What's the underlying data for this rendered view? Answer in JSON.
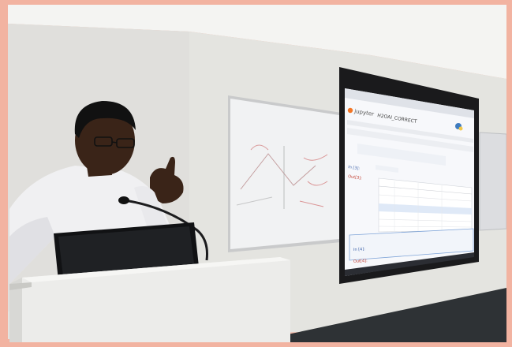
{
  "photo": {
    "description_hidden": false
  },
  "projection": {
    "app_name": "jupyter",
    "notebook_name": "H2OAI_CORRECT",
    "cell_in_1": "In [3]:",
    "cell_out_1": "Out[3]:",
    "cell_in_2": "In [4]:",
    "cell_out_2": "Out[4]:"
  },
  "colors": {
    "frame": "#f2b3a1",
    "wall": "#e6e6e2",
    "ceiling": "#f4f4f2",
    "floor": "#2e3235",
    "screen": "#f7f8fb",
    "screen_border": "#1a1a1c",
    "podium": "#ececea",
    "shirt": "#f2f2f4",
    "skin": "#3a2418",
    "accent": "#f37626"
  }
}
